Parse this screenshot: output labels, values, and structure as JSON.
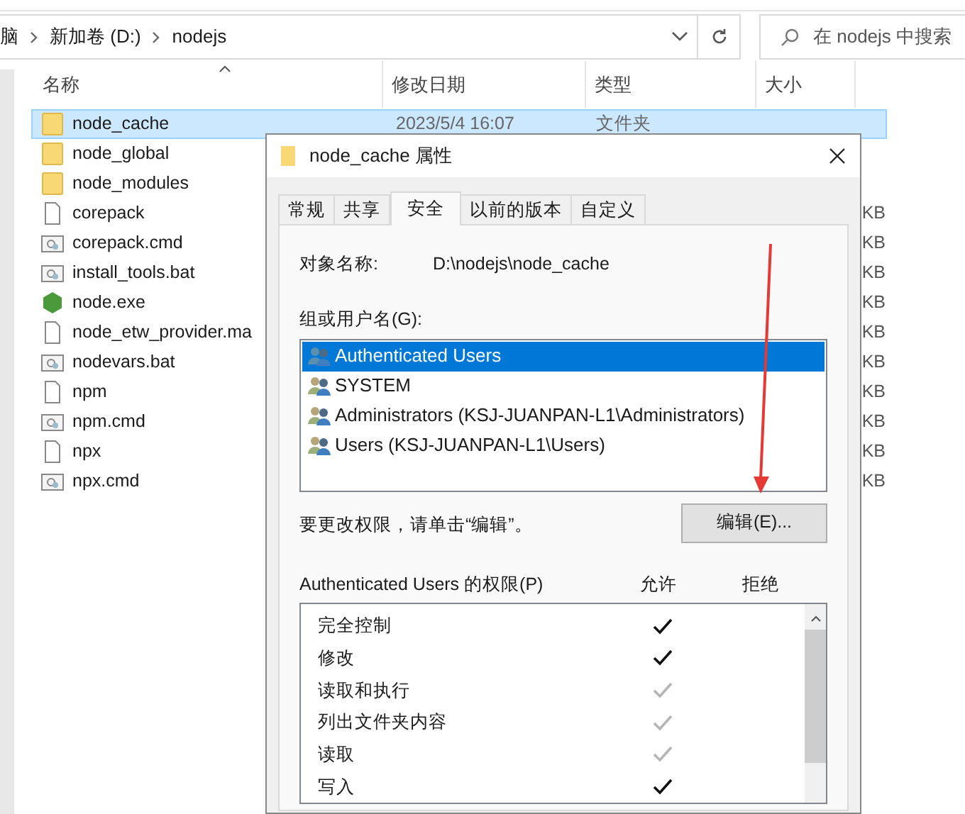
{
  "address_bar": {
    "breadcrumbs": [
      "脑",
      "新加卷 (D:)",
      "nodejs"
    ]
  },
  "search": {
    "placeholder": "在 nodejs 中搜索"
  },
  "columns": [
    "名称",
    "修改日期",
    "类型",
    "大小"
  ],
  "files": [
    {
      "name": "node_cache",
      "kind": "folder",
      "selected": true,
      "date": "2023/5/4 16:07",
      "type": "文件夹"
    },
    {
      "name": "node_global",
      "kind": "folder",
      "selected": false
    },
    {
      "name": "node_modules",
      "kind": "folder",
      "selected": false
    },
    {
      "name": "corepack",
      "kind": "file",
      "selected": false,
      "size": "KB"
    },
    {
      "name": "corepack.cmd",
      "kind": "script",
      "selected": false,
      "size": "KB"
    },
    {
      "name": "install_tools.bat",
      "kind": "script",
      "selected": false,
      "size": "KB"
    },
    {
      "name": "node.exe",
      "kind": "exe",
      "selected": false,
      "size": "KB"
    },
    {
      "name": "node_etw_provider.ma",
      "kind": "file",
      "selected": false,
      "size": "KB"
    },
    {
      "name": "nodevars.bat",
      "kind": "script",
      "selected": false,
      "size": "KB"
    },
    {
      "name": "npm",
      "kind": "file",
      "selected": false,
      "size": "KB"
    },
    {
      "name": "npm.cmd",
      "kind": "script",
      "selected": false,
      "size": "KB"
    },
    {
      "name": "npx",
      "kind": "file",
      "selected": false,
      "size": "KB"
    },
    {
      "name": "npx.cmd",
      "kind": "script",
      "selected": false,
      "size": "KB"
    }
  ],
  "dialog": {
    "title": "node_cache 属性",
    "tabs": [
      {
        "label": "常规",
        "selected": false
      },
      {
        "label": "共享",
        "selected": false
      },
      {
        "label": "安全",
        "selected": true
      },
      {
        "label": "以前的版本",
        "selected": false
      },
      {
        "label": "自定义",
        "selected": false
      }
    ],
    "object_label": "对象名称:",
    "object_value": "D:\\nodejs\\node_cache",
    "groups_label": "组或用户名(G):",
    "groups": [
      {
        "name": "Authenticated Users",
        "selected": true
      },
      {
        "name": "SYSTEM",
        "selected": false
      },
      {
        "name": "Administrators (KSJ-JUANPAN-L1\\Administrators)",
        "selected": false
      },
      {
        "name": "Users (KSJ-JUANPAN-L1\\Users)",
        "selected": false
      }
    ],
    "edit_hint": "要更改权限，请单击“编辑”。",
    "edit_button": "编辑(E)...",
    "permissions_label": "Authenticated Users 的权限(P)",
    "allow_header": "允许",
    "deny_header": "拒绝",
    "permissions": [
      {
        "name": "完全控制",
        "allow": true,
        "inherited": false,
        "deny": false
      },
      {
        "name": "修改",
        "allow": true,
        "inherited": false,
        "deny": false
      },
      {
        "name": "读取和执行",
        "allow": true,
        "inherited": true,
        "deny": false
      },
      {
        "name": "列出文件夹内容",
        "allow": true,
        "inherited": true,
        "deny": false
      },
      {
        "name": "读取",
        "allow": true,
        "inherited": true,
        "deny": false
      },
      {
        "name": "写入",
        "allow": true,
        "inherited": false,
        "deny": false
      }
    ]
  }
}
